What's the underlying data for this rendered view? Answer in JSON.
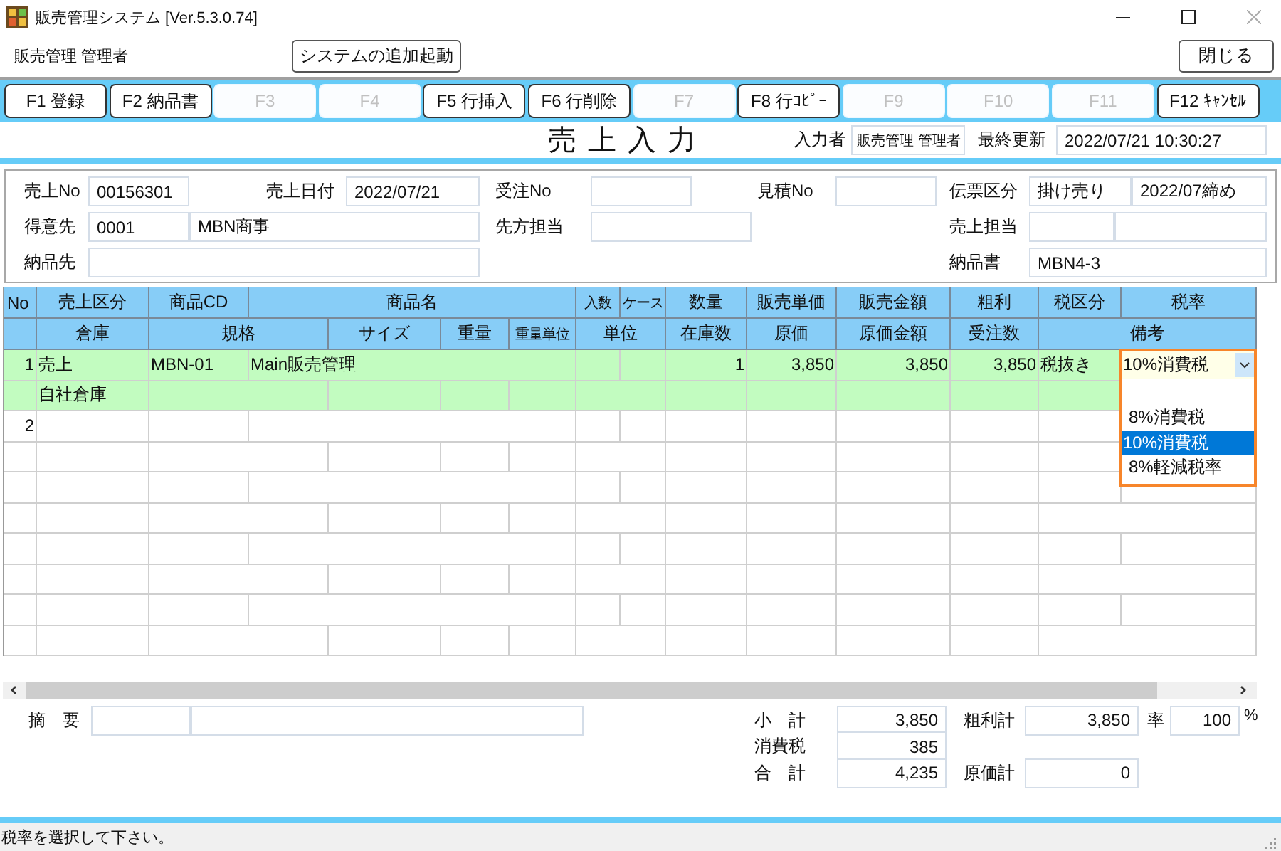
{
  "window": {
    "title": "販売管理システム [Ver.5.3.0.74]"
  },
  "user": "販売管理 管理者",
  "launch_button": "システムの追加起動",
  "close_button": "閉じる",
  "function_keys": [
    {
      "label": "F1 登録",
      "disabled": false
    },
    {
      "label": "F2 納品書",
      "disabled": false
    },
    {
      "label": "F3",
      "disabled": true
    },
    {
      "label": "F4",
      "disabled": true
    },
    {
      "label": "F5 行挿入",
      "disabled": false
    },
    {
      "label": "F6 行削除",
      "disabled": false
    },
    {
      "label": "F7",
      "disabled": true
    },
    {
      "label": "F8 行ｺﾋﾟｰ",
      "disabled": false
    },
    {
      "label": "F9",
      "disabled": true
    },
    {
      "label": "F10",
      "disabled": true
    },
    {
      "label": "F11",
      "disabled": true
    },
    {
      "label": "F12 ｷｬﾝｾﾙ",
      "disabled": false
    }
  ],
  "screen_title": "売上入力",
  "entered_by": {
    "label": "入力者",
    "value": "販売管理 管理者"
  },
  "last_updated": {
    "label": "最終更新",
    "value": "2022/07/21 10:30:27"
  },
  "header_form": {
    "sales_no": {
      "label": "売上No",
      "value": "00156301"
    },
    "sales_date": {
      "label": "売上日付",
      "value": "2022/07/21"
    },
    "order_no": {
      "label": "受注No"
    },
    "estimate_no": {
      "label": "見積No"
    },
    "slip_type": {
      "label": "伝票区分",
      "values": [
        "掛け売り",
        "2022/07締め"
      ]
    },
    "customer": {
      "label": "得意先",
      "code": "0001",
      "name": "MBN商事"
    },
    "contact": {
      "label": "先方担当"
    },
    "sales_rep": {
      "label": "売上担当"
    },
    "delivery_to": {
      "label": "納品先"
    },
    "delivery_note": {
      "label": "納品書",
      "value": "MBN4-3"
    }
  },
  "grid": {
    "header_top": [
      "No",
      "売上区分",
      "商品CD",
      "商品名",
      "入数",
      "ケース",
      "数量",
      "販売単価",
      "販売金額",
      "粗利",
      "税区分",
      "税率"
    ],
    "header_bottom": [
      "倉庫",
      "規格",
      "サイズ",
      "重量",
      "重量単位",
      "単位",
      "在庫数",
      "原価",
      "原価金額",
      "受注数",
      "備考"
    ],
    "rows": [
      {
        "no": "1",
        "selected": true,
        "cells": {
          "sales_type": "売上",
          "product_cd": "MBN-01",
          "product_name": "Main販売管理",
          "quantity": "1",
          "unit_price": "3,850",
          "amount": "3,850",
          "gross_profit": "3,850",
          "tax_type": "税抜き",
          "tax_rate": "10%消費税",
          "warehouse": "自社倉庫"
        }
      },
      {
        "no": "2",
        "selected": false,
        "cells": {}
      }
    ]
  },
  "tax_rate_list": {
    "open": true,
    "options": [
      {
        "label": "8%消費税",
        "selected": false
      },
      {
        "label": "10%消費税",
        "selected": true
      },
      {
        "label": "8%軽減税率",
        "selected": false
      }
    ]
  },
  "summary": {
    "memo": {
      "label": "摘　要"
    },
    "subtotal": {
      "label": "小　計",
      "value": "3,850"
    },
    "tax": {
      "label": "消費税",
      "value": "385"
    },
    "total": {
      "label": "合　計",
      "value": "4,235"
    },
    "gross_profit_total": {
      "label": "粗利計",
      "value": "3,850"
    },
    "margin": {
      "label": "率",
      "value": "100",
      "unit": "%"
    },
    "cost_total": {
      "label": "原価計",
      "value": "0"
    }
  },
  "status": "税率を選択して下さい。"
}
